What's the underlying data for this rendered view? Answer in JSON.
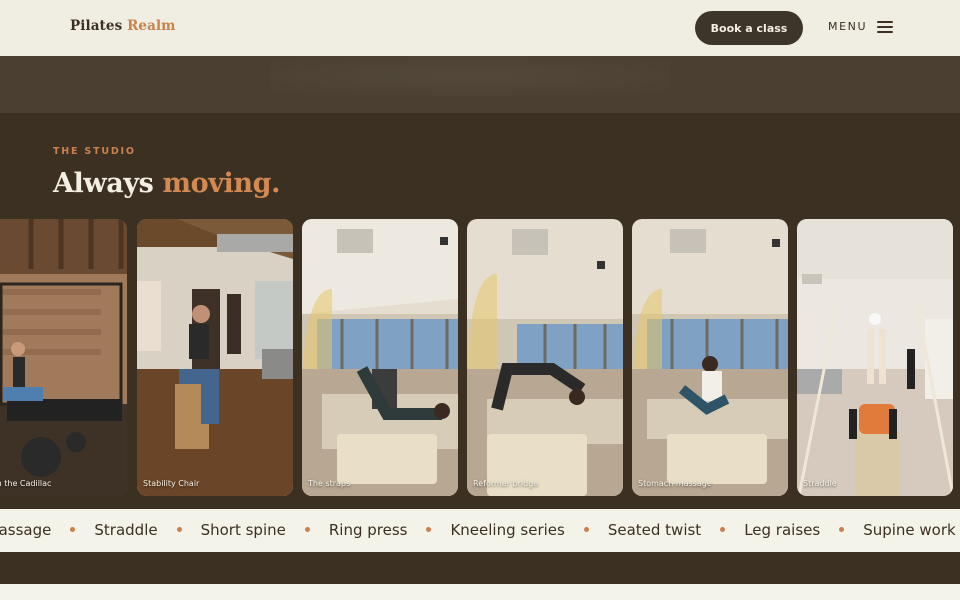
{
  "header": {
    "logo_text": "Pilates",
    "logo_accent": "Realm",
    "book_label": "Book a class",
    "menu_label": "MENU"
  },
  "studio": {
    "eyebrow": "THE STUDIO",
    "title": "Always",
    "title_accent": "moving."
  },
  "cards": [
    {
      "label": "oid on the Cadillac",
      "scene": "cadillac"
    },
    {
      "label": "Stability Chair",
      "scene": "chair"
    },
    {
      "label": "The straps",
      "scene": "studio"
    },
    {
      "label": "Reformer bridge",
      "scene": "studio"
    },
    {
      "label": "Stomach massage",
      "scene": "studio"
    },
    {
      "label": "Straddle",
      "scene": "white"
    }
  ],
  "marquee": [
    "massage",
    "Straddle",
    "Short spine",
    "Ring press",
    "Kneeling series",
    "Seated twist",
    "Leg raises",
    "Supine work"
  ],
  "colors": {
    "dark_brown": "#3b3022",
    "accent_orange": "#c9814e",
    "cream": "#f0ede2"
  }
}
